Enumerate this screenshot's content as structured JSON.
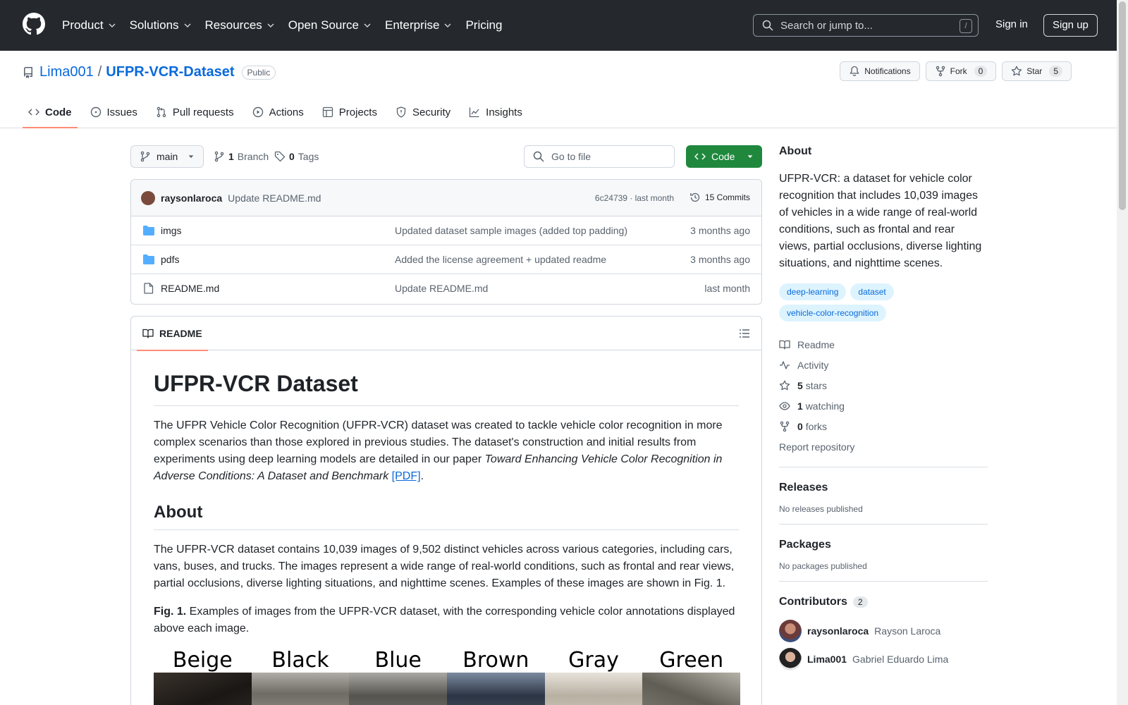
{
  "header": {
    "nav": [
      "Product",
      "Solutions",
      "Resources",
      "Open Source",
      "Enterprise",
      "Pricing"
    ],
    "search_placeholder": "Search or jump to...",
    "search_shortcut": "/",
    "sign_in": "Sign in",
    "sign_up": "Sign up"
  },
  "repo": {
    "owner": "Lima001",
    "separator": "/",
    "name": "UFPR-VCR-Dataset",
    "visibility": "Public",
    "notifications_label": "Notifications",
    "fork_label": "Fork",
    "fork_count": "0",
    "star_label": "Star",
    "star_count": "5",
    "tabs": [
      "Code",
      "Issues",
      "Pull requests",
      "Actions",
      "Projects",
      "Security",
      "Insights"
    ]
  },
  "filebar": {
    "branch": "main",
    "branch_count": "1",
    "branch_label": "Branch",
    "tag_count": "0",
    "tag_label": "Tags",
    "goto_placeholder": "Go to file",
    "code_button": "Code"
  },
  "commit": {
    "author": "raysonlaroca",
    "message": "Update README.md",
    "meta": "6c24739 · last month",
    "commits_label": "15 Commits"
  },
  "files": [
    {
      "name": "imgs",
      "type": "folder",
      "message": "Updated dataset sample images (added top padding)",
      "date": "3 months ago"
    },
    {
      "name": "pdfs",
      "type": "folder",
      "message": "Added the license agreement + updated readme",
      "date": "3 months ago"
    },
    {
      "name": "README.md",
      "type": "file",
      "message": "Update README.md",
      "date": "last month"
    }
  ],
  "readme": {
    "tab_label": "README",
    "title": "UFPR-VCR Dataset",
    "intro_pre": "The UFPR Vehicle Color Recognition (UFPR-VCR) dataset was created to tackle vehicle color recognition in more complex scenarios than those explored in previous studies. The dataset's construction and initial results from experiments using deep learning models are detailed in our paper ",
    "intro_italic": "Toward Enhancing Vehicle Color Recognition in Adverse Conditions: A Dataset and Benchmark",
    "intro_space": " ",
    "intro_link": "[PDF]",
    "intro_end": ".",
    "about_heading": "About",
    "about_text": "The UFPR-VCR dataset contains 10,039 images of 9,502 distinct vehicles across various categories, including cars, vans, buses, and trucks. The images represent a wide range of real-world conditions, such as frontal and rear views, partial occlusions, diverse lighting situations, and nighttime scenes. Examples of these images are shown in Fig. 1.",
    "fig_label": "Fig. 1.",
    "fig_caption": " Examples of images from the UFPR-VCR dataset, with the corresponding vehicle color annotations displayed above each image.",
    "figure_colors": [
      {
        "label": "Beige",
        "color": "#2b2622"
      },
      {
        "label": "Black",
        "color": "#8d8a84"
      },
      {
        "label": "Blue",
        "color": "#6d6c68"
      },
      {
        "label": "Brown",
        "color": "#3f4a5c"
      },
      {
        "label": "Gray",
        "color": "#c9c2b6"
      },
      {
        "label": "Green",
        "color": "#7c7a6f"
      }
    ]
  },
  "sidebar": {
    "about_heading": "About",
    "about_text": "UFPR-VCR: a dataset for vehicle color recognition that includes 10,039 images of vehicles in a wide range of real-world conditions, such as frontal and rear views, partial occlusions, diverse lighting situations, and nighttime scenes.",
    "topics": [
      "deep-learning",
      "dataset",
      "vehicle-color-recognition"
    ],
    "readme_link": "Readme",
    "activity_link": "Activity",
    "stars_count": "5",
    "stars_label": "stars",
    "watching_count": "1",
    "watching_label": "watching",
    "forks_count": "0",
    "forks_label": "forks",
    "report_link": "Report repository",
    "releases_heading": "Releases",
    "releases_text": "No releases published",
    "packages_heading": "Packages",
    "packages_text": "No packages published",
    "contributors_heading": "Contributors",
    "contributors_count": "2",
    "contributors": [
      {
        "login": "raysonlaroca",
        "name": "Rayson Laroca"
      },
      {
        "login": "Lima001",
        "name": "Gabriel Eduardo Lima"
      }
    ]
  },
  "colors": {
    "header_bg": "#25292e",
    "link": "#0969da",
    "green_button": "#1f883d",
    "tab_underline": "#fd8c73",
    "folder": "#54aeff"
  }
}
